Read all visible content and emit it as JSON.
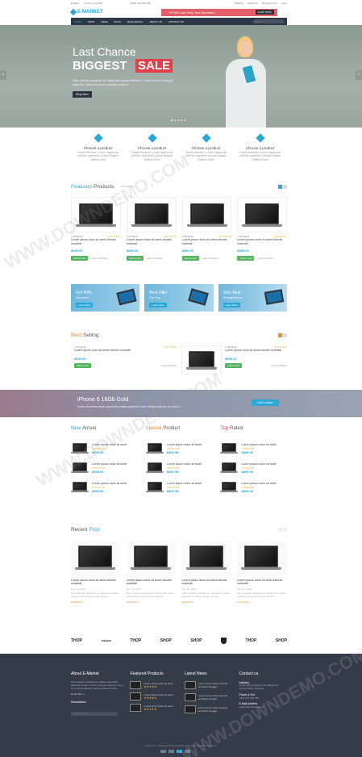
{
  "topbar": {
    "lang": "English",
    "currency": "Currency: EUR/$",
    "phone": "(+800) 123 456 789",
    "links": [
      "Wishlist",
      "Checkout",
      "Shopping Cart",
      "Login"
    ]
  },
  "header": {
    "logo": "E-MARKET",
    "promo_text": "Hi! We Can Help Your Business",
    "promo_button": "SHOP NOW!"
  },
  "nav": {
    "items": [
      "HOME",
      "SHOP",
      "PAGE",
      "BLOG",
      "BLOG DETAIL",
      "ABOUT US",
      "CONTACT US"
    ],
    "search_placeholder": "Search..."
  },
  "hero": {
    "line1": "Last Chance",
    "line2": "BIGGEST",
    "line3": "SALE",
    "desc": "Nam quamer pesaretre et, aliqua elio possie sefitertet. Coam eu etcur ceingue sapienet. Tean sem vorutz sapetter pulvinar.",
    "button": "Shop Now",
    "accent": "#e0404a"
  },
  "features": [
    {
      "title": "Choose a product",
      "desc": "Ceiam Aenean: Luctor agana ac pellicer eppetent Lornas Magna Sollitior Nem"
    },
    {
      "title": "Choose a product",
      "desc": "Ceiam Aenean: Luctor agana ac pellicer eppetent Lornas Magna Sollitior Nem"
    },
    {
      "title": "Choose a product",
      "desc": "Ceiam Aenean: Luctor agana ac pellicer eppetent Lornas Magna Sollitior Nem"
    },
    {
      "title": "Choose a product",
      "desc": "Ceiam Aenean: Luctor agana ac pellicer eppetent Lornas Magna Sollitior Nem"
    }
  ],
  "featured": {
    "title_a": "Featured",
    "title_b": "Products",
    "subtitle": "All Products >",
    "products": [
      {
        "cat": "Category",
        "name": "Lorem ipsum dolor sit amet lobortis molestie",
        "price": "$899.00",
        "cart": "Add to Cart",
        "wish": "Add to Wishlist"
      },
      {
        "cat": "Category",
        "name": "Lorem ipsum dolor sit amet lobortis molestie",
        "price": "$899.00",
        "cart": "Add to Cart",
        "wish": "Add to Wishlist"
      },
      {
        "cat": "Category",
        "name": "Lorem ipsum dolor sit amet lobortis molestie",
        "price": "$899.00",
        "cart": "Add to Cart",
        "wish": "Add to Wishlist"
      },
      {
        "cat": "Category",
        "name": "Lorem ipsum dolor sit amet lobortis molestie",
        "price": "$899.00",
        "cart": "Add to Cart",
        "wish": "Add to Wishlist"
      }
    ]
  },
  "banners": [
    {
      "title": "Get 50%",
      "sub": "Discount",
      "btn": "Learn More"
    },
    {
      "title": "Best Offer",
      "sub": "For You",
      "btn": "Learn More"
    },
    {
      "title": "Only Best",
      "sub": "Smartphones",
      "btn": "Learn More"
    }
  ],
  "best": {
    "title_a": "Best",
    "title_b": "Selling",
    "items": [
      {
        "cat": "Category",
        "name": "Lorem ipsum dolor sit amet lobortis molestie",
        "price": "$899.00",
        "cart": "Add to Cart",
        "wish": "Add to Wishlist"
      },
      {
        "cat": "Category",
        "name": "Lorem ipsum dolor sit amet lobortis molestie",
        "price": "$899.00",
        "cart": "Add to Cart",
        "wish": "Add to Wishlist"
      }
    ]
  },
  "promo": {
    "title": "iPhone 6 16Gb Gold",
    "desc": "Cream fermenta elelsd egetrid fel pelliate eppetent Lorem Sergos egestas fel politicil.",
    "button": "Call to Action"
  },
  "lists": {
    "new": {
      "a": "New",
      "b": "Arrival"
    },
    "special": {
      "a": "Special",
      "b": "Product"
    },
    "top": {
      "a": "Top",
      "b": "Rated"
    },
    "item": {
      "name": "Lorem ipsum dolor sit amet",
      "price": "$899.99"
    }
  },
  "recent": {
    "a": "Recent",
    "b": "Post",
    "posts": [
      {
        "title": "Lorem ipsum dolor sit amet lobortis molestie",
        "meta": "Nov 15, 2014",
        "desc": "Neus quamer pesaretre et, aliqua elio possie sefitertet at mauris ceingue lacinia.",
        "more": "Read More"
      },
      {
        "title": "Lorem ipsum dolor sit amet lobortis molestie",
        "meta": "Nov 15, 2014",
        "desc": "Neus quamer pesaretre et, aliqua elio possie sefitertet at mauris ceingue lacinia.",
        "more": "Read More"
      },
      {
        "title": "Lorem ipsum dolor sit amet lobortis molestie",
        "meta": "Nov 15, 2014",
        "desc": "Neus quamer pesaretre et, aliqua elio possie sefitertet at mauris ceingue lacinia.",
        "more": "Read More"
      },
      {
        "title": "Lorem ipsum dolor sit amet lobortis molestie",
        "meta": "Nov 15, 2014",
        "desc": "Neus quamer pesaretre et, aliqua elio possie sefitertet at mauris ceingue lacinia.",
        "more": "Read More"
      }
    ]
  },
  "brands": [
    "THOP",
    "THEHOP",
    "THOP",
    "SHOP",
    "SHOP",
    "SHOP",
    "THOP",
    "SHOP"
  ],
  "footer": {
    "about": {
      "title": "About E-Market",
      "text": "Nam quamer pesaretre et, aliqua elio possie sefitertet. Coam eu etcur ceingue sapienet. Tean sem vorutz sapetter pulvinar, lacinia metus.",
      "more": "Read More »",
      "newsletter": "Newsletter",
      "email_placeholder": "Email Address"
    },
    "featured": {
      "title": "Featured Products",
      "items": [
        "Lorem ipsum dolor sit amet",
        "Lorem ipsum dolor sit amet",
        "Lorem ipsum dolor sit amet"
      ]
    },
    "news": {
      "title": "Latest News",
      "items": [
        "Lorem ipsum dolor sit amet ac dictum feugiat",
        "Lorem ipsum dolor sit amet ac dictum feugiat",
        "Lorem ipsum dolor sit amet ac dictum feugiat"
      ]
    },
    "contact": {
      "title": "Contact us",
      "address_label": "Address",
      "address": "Lorem 123, Kingstone St. Melbourne, Victoria 3000, Australia",
      "phone_label": "Phone & Fax",
      "phone": "+800 123 456 789",
      "email_label": "E-Mail Address",
      "email": "support@company.com"
    },
    "copyright": "Copyright © E-Market 2014 All Rights Reserved. Template by Demo."
  },
  "watermark": "WWW.DOWNDEMO.COM"
}
